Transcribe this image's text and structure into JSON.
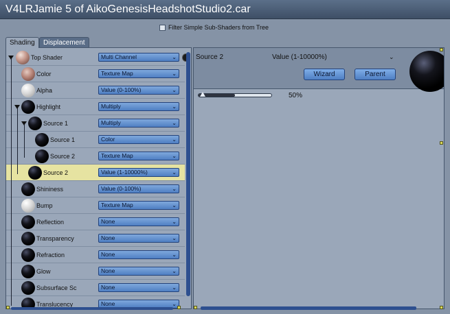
{
  "window": {
    "title": "V4LRJamie 5 of AikoGenesisHeadshotStudio2.car"
  },
  "filter": {
    "label": "Filter Simple Sub-Shaders from Tree",
    "checked": false
  },
  "tabs": [
    {
      "label": "Shading",
      "active": true
    },
    {
      "label": "Displacement",
      "active": false
    }
  ],
  "tree": {
    "rows": [
      {
        "label": "Top Shader",
        "value": "Multi Channel",
        "sphere": "skin"
      },
      {
        "label": "Color",
        "value": "Texture Map",
        "sphere": "skin2"
      },
      {
        "label": "Alpha",
        "value": "Value (0-100%)",
        "sphere": "white"
      },
      {
        "label": "Highlight",
        "value": "Multiply",
        "sphere": "black"
      },
      {
        "label": "Source 1",
        "value": "Multiply",
        "sphere": "black"
      },
      {
        "label": "Source 1",
        "value": "Color",
        "sphere": "black"
      },
      {
        "label": "Source 2",
        "value": "Texture Map",
        "sphere": "black"
      },
      {
        "label": "Source 2",
        "value": "Value (1-10000%)",
        "sphere": "black",
        "selected": true
      },
      {
        "label": "Shininess",
        "value": "Value (0-100%)",
        "sphere": "black"
      },
      {
        "label": "Bump",
        "value": "Texture Map",
        "sphere": "white"
      },
      {
        "label": "Reflection",
        "value": "None",
        "sphere": "black"
      },
      {
        "label": "Transparency",
        "value": "None",
        "sphere": "black"
      },
      {
        "label": "Refraction",
        "value": "None",
        "sphere": "black"
      },
      {
        "label": "Glow",
        "value": "None",
        "sphere": "black"
      },
      {
        "label": "Subsurface Sc",
        "value": "None",
        "sphere": "black"
      },
      {
        "label": "Translucency",
        "value": "None",
        "sphere": "black"
      }
    ]
  },
  "detail": {
    "title": "Source 2",
    "type": "Value (1-10000%)",
    "wizard_label": "Wizard",
    "parent_label": "Parent",
    "slider": {
      "value_text": "50%",
      "fraction": 0.5
    }
  },
  "icons": {
    "chevron": "chevron-double-down-icon",
    "trash": "trash-icon"
  },
  "colors": {
    "selection": "#e6e3a1",
    "accent": "#4f7fc3",
    "panel": "#9aa7b9"
  }
}
